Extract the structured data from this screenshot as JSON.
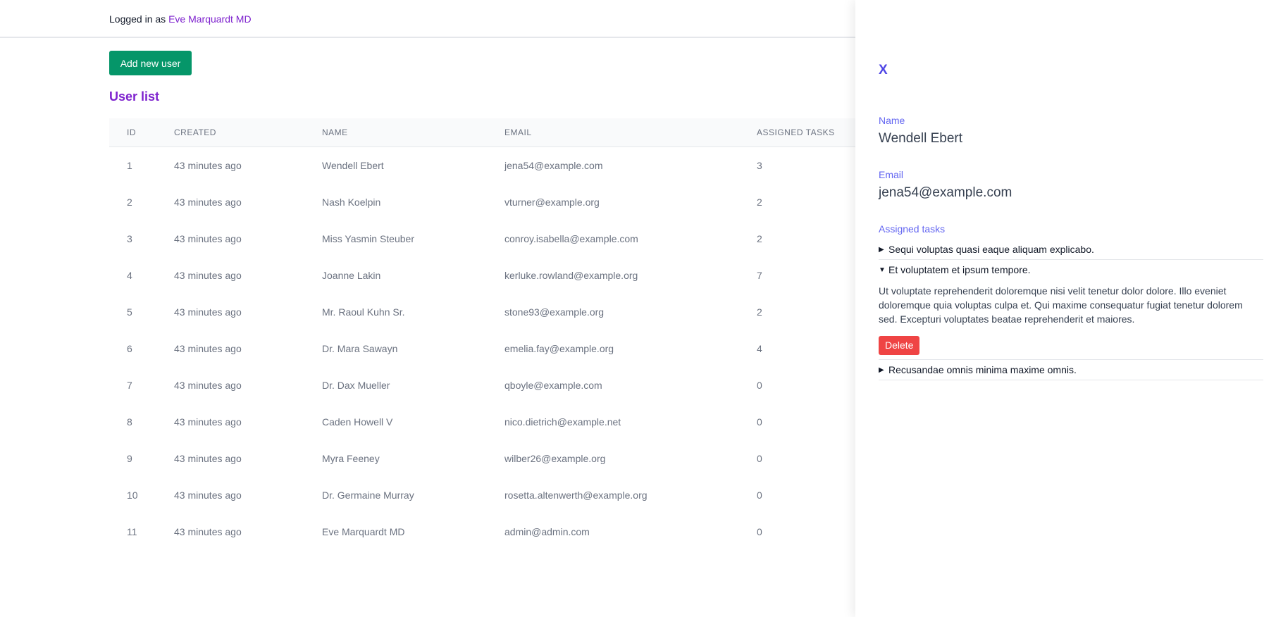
{
  "header": {
    "logged_in_prefix": "Logged in as",
    "current_user": "Eve Marquardt MD"
  },
  "main": {
    "add_button": "Add new user",
    "title": "User list",
    "columns": [
      "ID",
      "CREATED",
      "NAME",
      "EMAIL",
      "ASSIGNED TASKS"
    ],
    "rows": [
      {
        "id": "1",
        "created": "43 minutes ago",
        "name": "Wendell Ebert",
        "email": "jena54@example.com",
        "tasks": "3"
      },
      {
        "id": "2",
        "created": "43 minutes ago",
        "name": "Nash Koelpin",
        "email": "vturner@example.org",
        "tasks": "2"
      },
      {
        "id": "3",
        "created": "43 minutes ago",
        "name": "Miss Yasmin Steuber",
        "email": "conroy.isabella@example.com",
        "tasks": "2"
      },
      {
        "id": "4",
        "created": "43 minutes ago",
        "name": "Joanne Lakin",
        "email": "kerluke.rowland@example.org",
        "tasks": "7"
      },
      {
        "id": "5",
        "created": "43 minutes ago",
        "name": "Mr. Raoul Kuhn Sr.",
        "email": "stone93@example.org",
        "tasks": "2"
      },
      {
        "id": "6",
        "created": "43 minutes ago",
        "name": "Dr. Mara Sawayn",
        "email": "emelia.fay@example.org",
        "tasks": "4"
      },
      {
        "id": "7",
        "created": "43 minutes ago",
        "name": "Dr. Dax Mueller",
        "email": "qboyle@example.com",
        "tasks": "0"
      },
      {
        "id": "8",
        "created": "43 minutes ago",
        "name": "Caden Howell V",
        "email": "nico.dietrich@example.net",
        "tasks": "0"
      },
      {
        "id": "9",
        "created": "43 minutes ago",
        "name": "Myra Feeney",
        "email": "wilber26@example.org",
        "tasks": "0"
      },
      {
        "id": "10",
        "created": "43 minutes ago",
        "name": "Dr. Germaine Murray",
        "email": "rosetta.altenwerth@example.org",
        "tasks": "0"
      },
      {
        "id": "11",
        "created": "43 minutes ago",
        "name": "Eve Marquardt MD",
        "email": "admin@admin.com",
        "tasks": "0"
      }
    ]
  },
  "panel": {
    "close_label": "X",
    "name_label": "Name",
    "name_value": "Wendell Ebert",
    "email_label": "Email",
    "email_value": "jena54@example.com",
    "tasks_label": "Assigned tasks",
    "tasks": [
      {
        "title": "Sequi voluptas quasi eaque aliquam explicabo.",
        "expanded": false,
        "body": ""
      },
      {
        "title": "Et voluptatem et ipsum tempore.",
        "expanded": true,
        "body": "Ut voluptate reprehenderit doloremque nisi velit tenetur dolor dolore. Illo eveniet doloremque quia voluptas culpa et. Qui maxime consequatur fugiat tenetur dolorem sed. Excepturi voluptates beatae reprehenderit et maiores."
      },
      {
        "title": "Recusandae omnis minima maxime omnis.",
        "expanded": false,
        "body": ""
      }
    ],
    "delete_label": "Delete"
  },
  "colors": {
    "accent_purple": "#7e22ce",
    "indigo": "#4f46e5",
    "primary_green": "#059669",
    "danger_red": "#ef4444"
  },
  "icons": {
    "collapsed": "triangle-right-icon",
    "expanded": "triangle-down-icon"
  }
}
